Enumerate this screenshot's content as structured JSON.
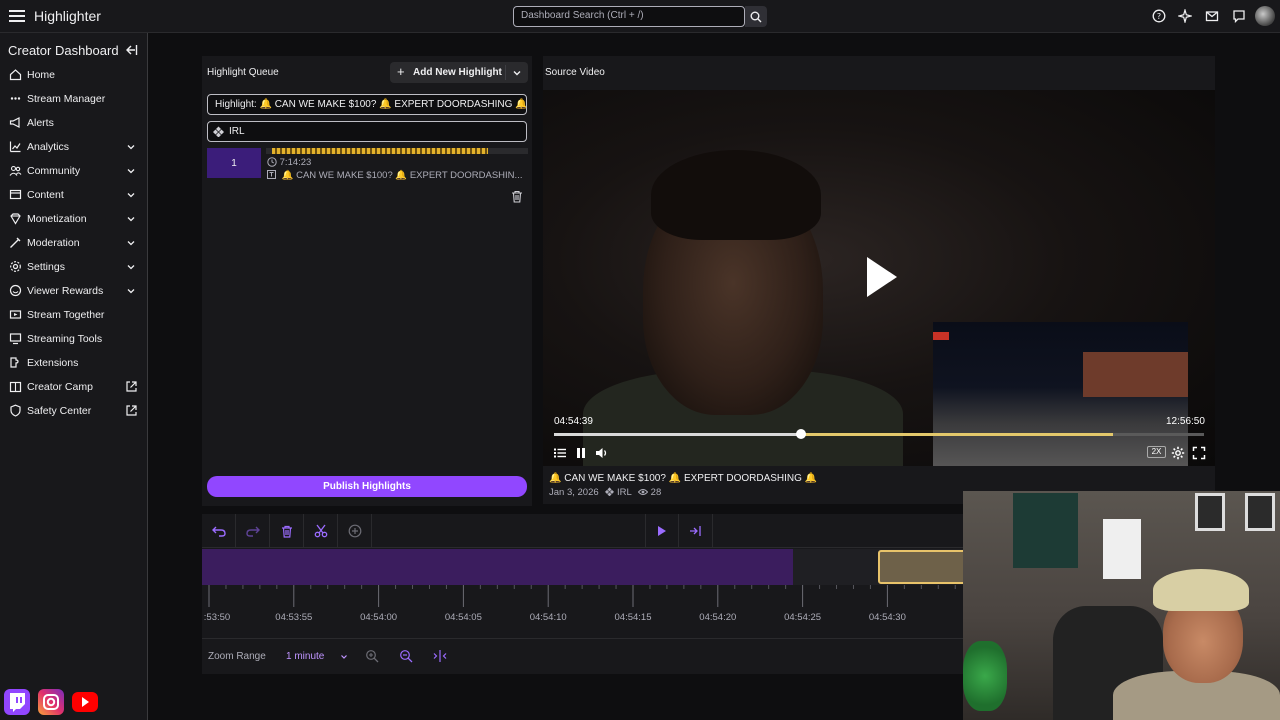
{
  "app": {
    "title": "Highlighter",
    "search_placeholder": "Dashboard Search (Ctrl + /)"
  },
  "sidebar": {
    "title": "Creator Dashboard",
    "items": [
      {
        "label": "Home",
        "icon": "home-icon",
        "chevron": false,
        "external": false
      },
      {
        "label": "Stream Manager",
        "icon": "stream-manager-icon",
        "chevron": false,
        "external": false
      },
      {
        "label": "Alerts",
        "icon": "megaphone-icon",
        "chevron": false,
        "external": false
      },
      {
        "label": "Analytics",
        "icon": "analytics-icon",
        "chevron": true,
        "external": false
      },
      {
        "label": "Community",
        "icon": "community-icon",
        "chevron": true,
        "external": false
      },
      {
        "label": "Content",
        "icon": "content-icon",
        "chevron": true,
        "external": false
      },
      {
        "label": "Monetization",
        "icon": "monetization-icon",
        "chevron": true,
        "external": false
      },
      {
        "label": "Moderation",
        "icon": "moderation-icon",
        "chevron": true,
        "external": false
      },
      {
        "label": "Settings",
        "icon": "gear-icon",
        "chevron": true,
        "external": false
      },
      {
        "label": "Viewer Rewards",
        "icon": "rewards-icon",
        "chevron": true,
        "external": false
      },
      {
        "label": "Stream Together",
        "icon": "stream-together-icon",
        "chevron": false,
        "external": false
      },
      {
        "label": "Streaming Tools",
        "icon": "streaming-tools-icon",
        "chevron": false,
        "external": false
      },
      {
        "label": "Extensions",
        "icon": "extensions-icon",
        "chevron": false,
        "external": false
      },
      {
        "label": "Creator Camp",
        "icon": "creator-camp-icon",
        "chevron": false,
        "external": true
      },
      {
        "label": "Safety Center",
        "icon": "shield-icon",
        "chevron": false,
        "external": true
      }
    ]
  },
  "queue": {
    "title": "Highlight Queue",
    "add_button": "Add New Highlight",
    "highlight_field": "Highlight: 🔔 CAN WE MAKE $100? 🔔 EXPERT DOORDASHING 🔔",
    "category_field": "IRL",
    "item": {
      "number": "1",
      "duration": "7:14:23",
      "title": "🔔 CAN WE MAKE $100? 🔔 EXPERT DOORDASHIN..."
    },
    "publish_button": "Publish Highlights"
  },
  "video": {
    "title": "Source Video",
    "current_time": "04:54:39",
    "total_time": "12:56:50",
    "progress": 0.38,
    "highlight_range": [
      0.38,
      0.86
    ],
    "speed": "2X",
    "stream_title": "🔔 CAN WE MAKE $100? 🔔 EXPERT DOORDASHING 🔔",
    "date": "Jan 3, 2026",
    "category": "IRL",
    "views": "28"
  },
  "timeline": {
    "ticks": [
      ":53:50",
      "04:53:55",
      "04:54:00",
      "04:54:05",
      "04:54:10",
      "04:54:15",
      "04:54:20",
      "04:54:25",
      "04:54:30",
      "04"
    ],
    "zoom_label": "Zoom Range",
    "zoom_value": "1 minute"
  },
  "colors": {
    "accent": "#9147ff",
    "clip_fill": "#3b1d5e",
    "clip_selected_border": "#e8c36a"
  }
}
